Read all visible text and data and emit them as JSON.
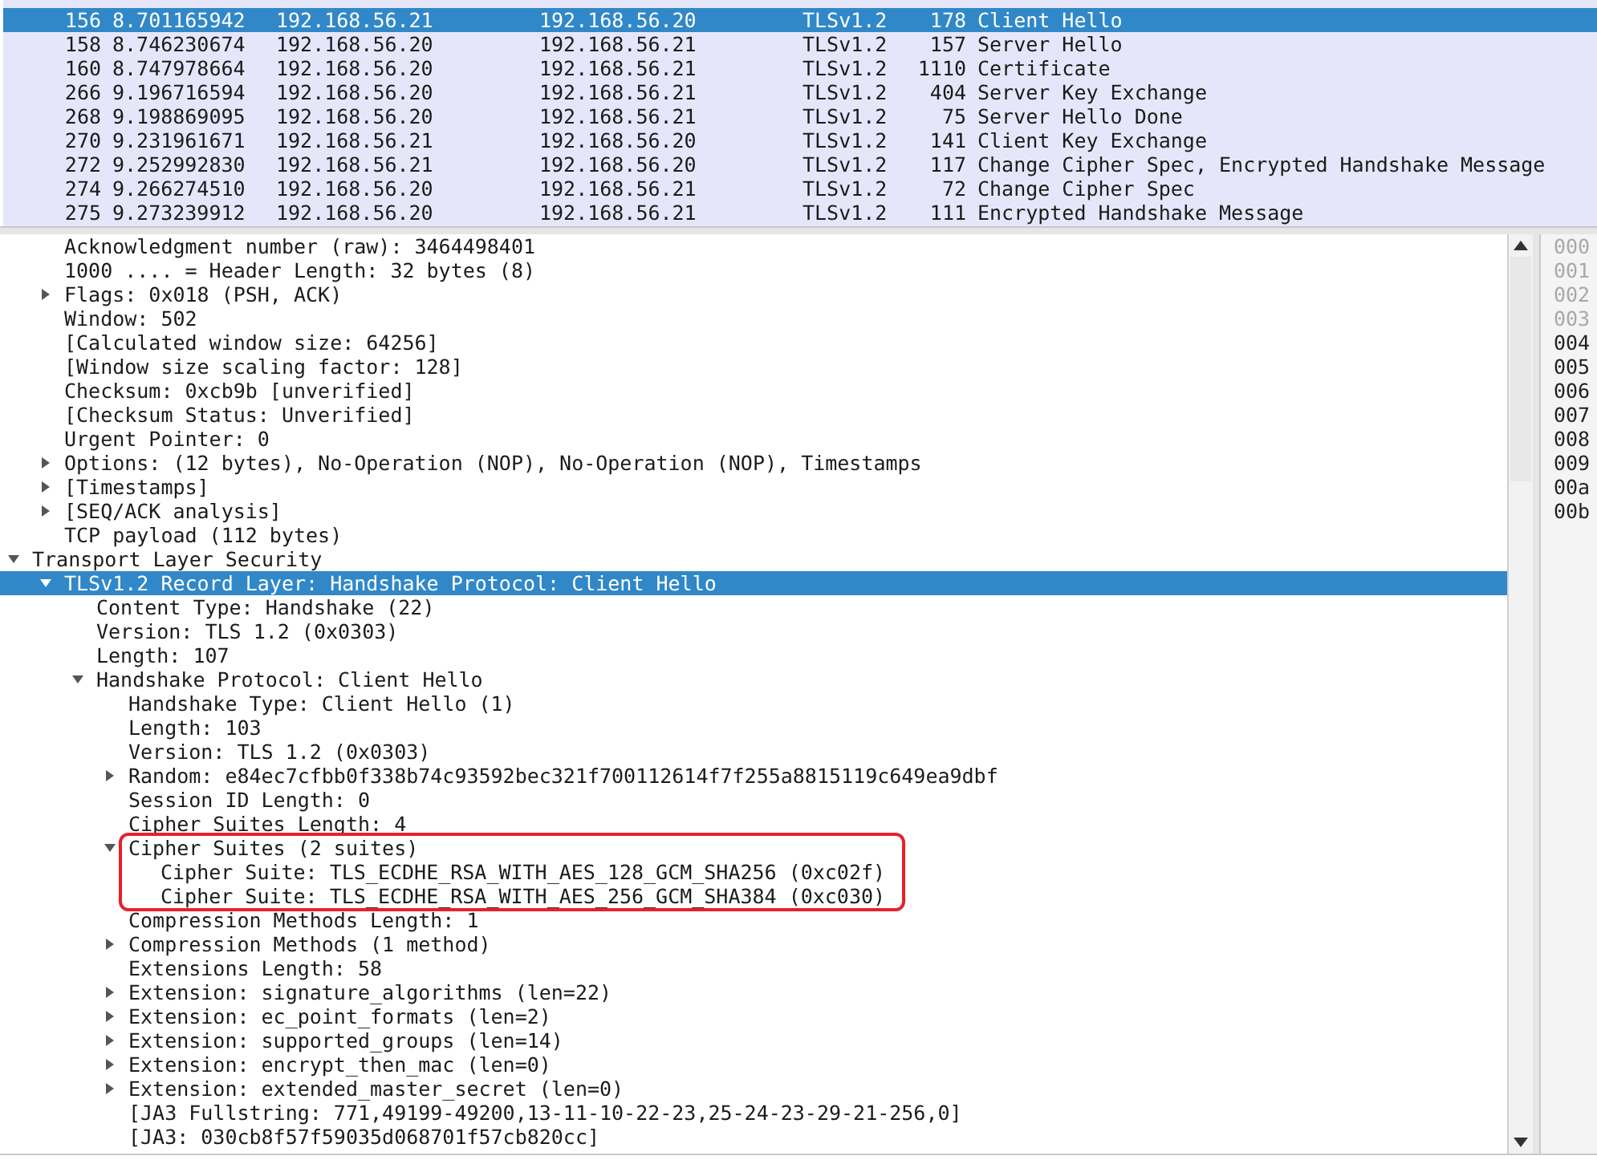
{
  "packet_list": {
    "rows": [
      {
        "no": "156",
        "time": "8.701165942",
        "source": "192.168.56.21",
        "destination": "192.168.56.20",
        "protocol": "TLSv1.2",
        "length": "178",
        "info": "Client Hello",
        "selected": true
      },
      {
        "no": "158",
        "time": "8.746230674",
        "source": "192.168.56.20",
        "destination": "192.168.56.21",
        "protocol": "TLSv1.2",
        "length": "157",
        "info": "Server Hello",
        "selected": false
      },
      {
        "no": "160",
        "time": "8.747978664",
        "source": "192.168.56.20",
        "destination": "192.168.56.21",
        "protocol": "TLSv1.2",
        "length": "1110",
        "info": "Certificate",
        "selected": false
      },
      {
        "no": "266",
        "time": "9.196716594",
        "source": "192.168.56.20",
        "destination": "192.168.56.21",
        "protocol": "TLSv1.2",
        "length": "404",
        "info": "Server Key Exchange",
        "selected": false
      },
      {
        "no": "268",
        "time": "9.198869095",
        "source": "192.168.56.20",
        "destination": "192.168.56.21",
        "protocol": "TLSv1.2",
        "length": "75",
        "info": "Server Hello Done",
        "selected": false
      },
      {
        "no": "270",
        "time": "9.231961671",
        "source": "192.168.56.21",
        "destination": "192.168.56.20",
        "protocol": "TLSv1.2",
        "length": "141",
        "info": "Client Key Exchange",
        "selected": false
      },
      {
        "no": "272",
        "time": "9.252992830",
        "source": "192.168.56.21",
        "destination": "192.168.56.20",
        "protocol": "TLSv1.2",
        "length": "117",
        "info": "Change Cipher Spec, Encrypted Handshake Message",
        "selected": false
      },
      {
        "no": "274",
        "time": "9.266274510",
        "source": "192.168.56.20",
        "destination": "192.168.56.21",
        "protocol": "TLSv1.2",
        "length": "72",
        "info": "Change Cipher Spec",
        "selected": false
      },
      {
        "no": "275",
        "time": "9.273239912",
        "source": "192.168.56.20",
        "destination": "192.168.56.21",
        "protocol": "TLSv1.2",
        "length": "111",
        "info": "Encrypted Handshake Message",
        "selected": false
      }
    ]
  },
  "packet_details": {
    "tcp_fields_continued": [
      {
        "label": "Acknowledgment number (raw): 3464498401",
        "selected": false
      },
      {
        "label": "1000 .... = Header Length: 32 bytes (8)",
        "selected": false
      },
      {
        "label": "Flags: 0x018 (PSH, ACK)",
        "selected": false,
        "expanded": false
      },
      {
        "label": "Window: 502",
        "selected": false
      },
      {
        "label": "[Calculated window size: 64256]",
        "selected": false
      },
      {
        "label": "[Window size scaling factor: 128]",
        "selected": false
      },
      {
        "label": "Checksum: 0xcb9b [unverified]",
        "selected": false
      },
      {
        "label": "[Checksum Status: Unverified]",
        "selected": false
      },
      {
        "label": "Urgent Pointer: 0",
        "selected": false
      },
      {
        "label": "Options: (12 bytes), No-Operation (NOP), No-Operation (NOP), Timestamps",
        "selected": false,
        "expanded": false
      },
      {
        "label": "[Timestamps]",
        "selected": false,
        "expanded": false
      },
      {
        "label": "[SEQ/ACK analysis]",
        "selected": false,
        "expanded": false
      },
      {
        "label": "TCP payload (112 bytes)",
        "selected": false
      }
    ],
    "tree": [
      {
        "label": "Transport Layer Security",
        "selected": false,
        "expanded": true,
        "children": [
          {
            "label": "TLSv1.2 Record Layer: Handshake Protocol: Client Hello",
            "selected": true,
            "expanded": true,
            "children": [
              {
                "label": "Content Type: Handshake (22)",
                "selected": false
              },
              {
                "label": "Version: TLS 1.2 (0x0303)",
                "selected": false
              },
              {
                "label": "Length: 107",
                "selected": false
              },
              {
                "label": "Handshake Protocol: Client Hello",
                "selected": false,
                "expanded": true,
                "children": [
                  {
                    "label": "Handshake Type: Client Hello (1)",
                    "selected": false
                  },
                  {
                    "label": "Length: 103",
                    "selected": false
                  },
                  {
                    "label": "Version: TLS 1.2 (0x0303)",
                    "selected": false
                  },
                  {
                    "label": "Random: e84ec7cfbb0f338b74c93592bec321f700112614f7f255a8815119c649ea9dbf",
                    "selected": false,
                    "expanded": false
                  },
                  {
                    "label": "Session ID Length: 0",
                    "selected": false
                  },
                  {
                    "label": "Cipher Suites Length: 4",
                    "selected": false
                  },
                  {
                    "label": "Cipher Suites (2 suites)",
                    "selected": false,
                    "expanded": true,
                    "annotated": true,
                    "children": [
                      {
                        "label": "Cipher Suite: TLS_ECDHE_RSA_WITH_AES_128_GCM_SHA256 (0xc02f)",
                        "selected": false
                      },
                      {
                        "label": "Cipher Suite: TLS_ECDHE_RSA_WITH_AES_256_GCM_SHA384 (0xc030)",
                        "selected": false
                      }
                    ]
                  },
                  {
                    "label": "Compression Methods Length: 1",
                    "selected": false
                  },
                  {
                    "label": "Compression Methods (1 method)",
                    "selected": false,
                    "expanded": false
                  },
                  {
                    "label": "Extensions Length: 58",
                    "selected": false
                  },
                  {
                    "label": "Extension: signature_algorithms (len=22)",
                    "selected": false,
                    "expanded": false
                  },
                  {
                    "label": "Extension: ec_point_formats (len=2)",
                    "selected": false,
                    "expanded": false
                  },
                  {
                    "label": "Extension: supported_groups (len=14)",
                    "selected": false,
                    "expanded": false
                  },
                  {
                    "label": "Extension: encrypt_then_mac (len=0)",
                    "selected": false,
                    "expanded": false
                  },
                  {
                    "label": "Extension: extended_master_secret (len=0)",
                    "selected": false,
                    "expanded": false
                  },
                  {
                    "label": "[JA3 Fullstring: 771,49199-49200,13-11-10-22-23,25-24-23-29-21-256,0]",
                    "selected": false
                  },
                  {
                    "label": "[JA3: 030cb8f57f59035d068701f57cb820cc]",
                    "selected": false
                  }
                ]
              }
            ]
          }
        ]
      }
    ]
  },
  "bytes_pane": {
    "offsets": [
      {
        "text": "000",
        "in_selection": false
      },
      {
        "text": "001",
        "in_selection": false
      },
      {
        "text": "002",
        "in_selection": false
      },
      {
        "text": "003",
        "in_selection": false
      },
      {
        "text": "004",
        "in_selection": true
      },
      {
        "text": "005",
        "in_selection": true
      },
      {
        "text": "006",
        "in_selection": true
      },
      {
        "text": "007",
        "in_selection": true
      },
      {
        "text": "008",
        "in_selection": true
      },
      {
        "text": "009",
        "in_selection": true
      },
      {
        "text": "00a",
        "in_selection": true
      },
      {
        "text": "00b",
        "in_selection": true
      }
    ]
  }
}
